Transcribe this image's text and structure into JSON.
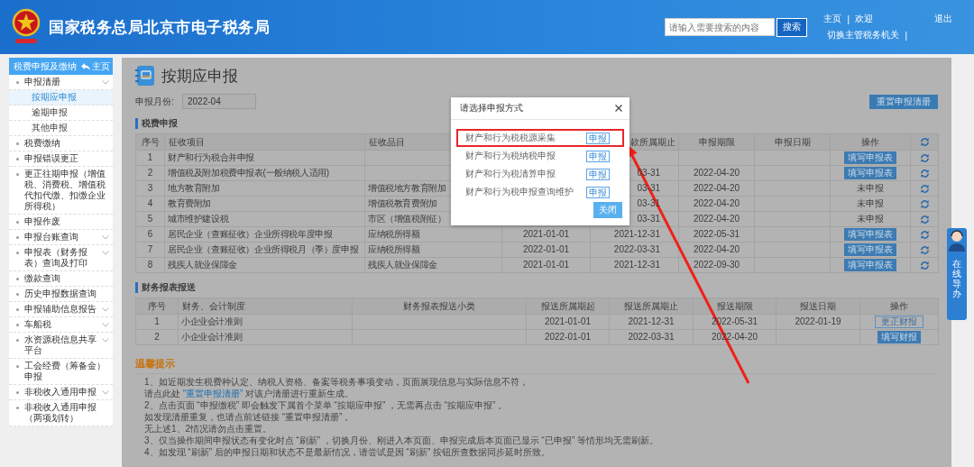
{
  "header": {
    "title": "国家税务总局北京市电子税务局",
    "search_placeholder": "请输入需要搜索的内容",
    "search_button": "搜索",
    "home_link": "主页",
    "separators": [
      "|",
      "|"
    ],
    "welcome": "欢迎",
    "logout_link": "退出",
    "switch_link": "切换主管税务机关"
  },
  "sidebar": {
    "title": "税费申报及缴纳",
    "home": "主页",
    "items": [
      {
        "label": "申报清册",
        "has_submenu": true,
        "selected": false,
        "children": [
          {
            "label": "按期应申报",
            "selected": true
          },
          {
            "label": "逾期申报",
            "selected": false
          },
          {
            "label": "其他申报",
            "selected": false
          }
        ]
      },
      {
        "label": "税费缴纳",
        "has_submenu": false,
        "selected": false
      },
      {
        "label": "申报错误更正",
        "has_submenu": false,
        "selected": false
      },
      {
        "label": "更正往期申报（增值税、消费税、增值税代扣代缴、扣缴企业所得税）",
        "has_submenu": false,
        "selected": false
      },
      {
        "label": "申报作废",
        "has_submenu": false,
        "selected": false
      },
      {
        "label": "申报台账查询",
        "has_submenu": true,
        "selected": false
      },
      {
        "label": "申报表（财务报表）查询及打印",
        "has_submenu": true,
        "selected": false
      },
      {
        "label": "缴款查询",
        "has_submenu": false,
        "selected": false
      },
      {
        "label": "历史申报数据查询",
        "has_submenu": false,
        "selected": false
      },
      {
        "label": "申报辅助信息报告",
        "has_submenu": true,
        "selected": false
      },
      {
        "label": "车船税",
        "has_submenu": true,
        "selected": false
      },
      {
        "label": "水资源税信息共享平台",
        "has_submenu": true,
        "selected": false
      },
      {
        "label": "工会经费（筹备金）申报",
        "has_submenu": false,
        "selected": false
      },
      {
        "label": "非税收入通用申报",
        "has_submenu": true,
        "selected": false
      },
      {
        "label": "非税收入通用申报（两项划转）",
        "has_submenu": false,
        "selected": false
      }
    ]
  },
  "page": {
    "title": "按期应申报",
    "month_label": "申报月份:",
    "month_value": "2022-04",
    "reset_button": "重置申报清册"
  },
  "tax_section": {
    "title": "税费申报",
    "header": {
      "no": "序号",
      "item": "征收项目",
      "subitem": "征收品目",
      "period_end": "款所属期止",
      "deadline": "申报期限",
      "filed_date": "申报日期",
      "action": "操作"
    },
    "rows": [
      {
        "no": "1",
        "item": "财产和行为税合并申报",
        "action": {
          "kind": "filled",
          "label": "填写申报表"
        }
      },
      {
        "no": "2",
        "item": "增值税及附加税费申报表(一般纳税人适用)",
        "period_end": "03-31",
        "deadline": "2022-04-20",
        "action": {
          "kind": "filled",
          "label": "填写申报表"
        }
      },
      {
        "no": "3",
        "item": "地方教育附加",
        "subitem": "增值税地方教育附加",
        "period_end": "03-31",
        "deadline": "2022-04-20",
        "action": {
          "kind": "status",
          "label": "未申报"
        }
      },
      {
        "no": "4",
        "item": "教育费附加",
        "subitem": "增值税教育费附加",
        "period_end": "03-31",
        "deadline": "2022-04-20",
        "action": {
          "kind": "status",
          "label": "未申报"
        }
      },
      {
        "no": "5",
        "item": "城市维护建设税",
        "subitem": "市区（增值税附征）",
        "period_end": "03-31",
        "deadline": "2022-04-20",
        "action": {
          "kind": "status",
          "label": "未申报"
        }
      },
      {
        "no": "6",
        "item": "居民企业（查账征收）企业所得税年度申报",
        "subitem": "应纳税所得额",
        "period_start": "2021-01-01",
        "period_end": "2021-12-31",
        "deadline": "2022-05-31",
        "action": {
          "kind": "filled",
          "label": "填写申报表"
        }
      },
      {
        "no": "7",
        "item": "居民企业（查账征收）企业所得税月（季）度申报",
        "subitem": "应纳税所得额",
        "period_start": "2022-01-01",
        "period_end": "2022-03-31",
        "deadline": "2022-04-20",
        "action": {
          "kind": "filled",
          "label": "填写申报表"
        }
      },
      {
        "no": "8",
        "item": "残疾人就业保障金",
        "subitem": "残疾人就业保障金",
        "period_start": "2021-01-01",
        "period_end": "2021-12-31",
        "deadline": "2022-09-30",
        "action": {
          "kind": "filled",
          "label": "填写申报表"
        }
      }
    ]
  },
  "finance_section": {
    "title": "财务报表报送",
    "header": {
      "no": "序号",
      "standard": "财务、会计制度",
      "category": "财务报表报送小类",
      "period_start": "报送所属期起",
      "period_end": "报送所属期止",
      "deadline": "报送期限",
      "sent_date": "报送日期",
      "action": "操作"
    },
    "rows": [
      {
        "no": "1",
        "standard": "小企业会计准则",
        "period_start": "2021-01-01",
        "period_end": "2021-12-31",
        "deadline": "2022-05-31",
        "sent_date": "2022-01-19",
        "action": {
          "kind": "outline",
          "label": "更正财报"
        }
      },
      {
        "no": "2",
        "standard": "小企业会计准则",
        "period_start": "2022-01-01",
        "period_end": "2022-03-31",
        "deadline": "2022-04-20",
        "action": {
          "kind": "filled",
          "label": "填写财报"
        }
      }
    ]
  },
  "tips": {
    "title": "温馨提示",
    "lines": [
      {
        "kind": "plain",
        "text": "1、如近期发生税费种认定、纳税人资格、备案等税务事项变动，页面展现信息与实际信息不符，"
      },
      {
        "kind": "link",
        "before": "请点此处 ",
        "link": "“重置申报清册”",
        "after": " 对该户清册进行重新生成。"
      },
      {
        "kind": "plain",
        "text": "2、点击页面 “申报缴税” 即会触发下属首个菜单 “按期应申报” ，无需再点击 “按期应申报” 。"
      },
      {
        "kind": "plain",
        "text": "如发现清册重复，也请点前述链接 “重置申报清册” 。"
      },
      {
        "kind": "plain",
        "text": "无上述1、2情况请勿点击重置。"
      },
      {
        "kind": "plain",
        "text": "3、仅当操作期间申报状态有变化时点 “刷新” ，切换月份、刚进入本页面、申报完成后本页面已显示 “已申报” 等情形均无需刷新。"
      },
      {
        "kind": "plain",
        "text": "4、如发现 “刷新” 后的申报日期和状态不是最新情况，请尝试是因 “刷新” 按钮所查数据同步延时所致。"
      }
    ]
  },
  "modal": {
    "title": "请选择申报方式",
    "options": [
      {
        "label": "财产和行为税税源采集",
        "button": "申报",
        "highlighted": true
      },
      {
        "label": "财产和行为税纳税申报",
        "button": "申报",
        "highlighted": false
      },
      {
        "label": "财产和行为税清算申报",
        "button": "申报",
        "highlighted": false
      },
      {
        "label": "财产和行为税申报查询维护",
        "button": "申报",
        "highlighted": false
      }
    ],
    "close_button": "关闭"
  },
  "widget": {
    "label": "在线导办"
  }
}
